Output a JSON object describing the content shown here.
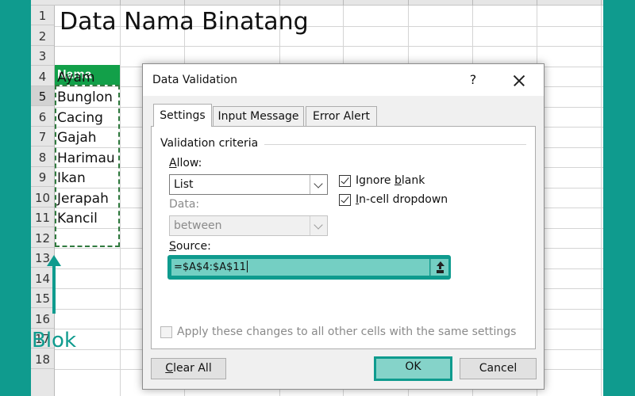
{
  "sheet": {
    "title": "Data Nama Binatang",
    "header": "Nama",
    "names": [
      "Ayam",
      "Bunglon",
      "Cacing",
      "Gajah",
      "Harimau",
      "Ikan",
      "Jerapah",
      "Kancil"
    ],
    "row_numbers": [
      "1",
      "2",
      "3",
      "4",
      "5",
      "6",
      "7",
      "8",
      "9",
      "10",
      "11",
      "12",
      "13",
      "14",
      "15",
      "16",
      "17",
      "18"
    ],
    "selected_row": "5"
  },
  "annotation": {
    "label": "Blok",
    "color": "#0f9b8e"
  },
  "dialog": {
    "title": "Data Validation",
    "help_label": "?",
    "tabs": [
      {
        "label": "Settings",
        "active": true
      },
      {
        "label": "Input Message",
        "active": false
      },
      {
        "label": "Error Alert",
        "active": false
      }
    ],
    "criteria_label": "Validation criteria",
    "allow_label": "Allow:",
    "allow_value": "List",
    "data_label": "Data:",
    "data_value": "between",
    "ignore_blank_label": "Ignore blank",
    "ignore_blank_checked": true,
    "in_cell_dropdown_label": "In-cell dropdown",
    "in_cell_dropdown_checked": true,
    "source_label": "Source:",
    "source_value": "=$A$4:$A$11",
    "apply_all_label": "Apply these changes to all other cells with the same settings",
    "apply_all_checked": false,
    "clear_all_label": "Clear All",
    "ok_label": "OK",
    "cancel_label": "Cancel"
  },
  "colors": {
    "accent": "#0f9b8e",
    "header_green": "#12a049",
    "highlight": "#74cfc3"
  }
}
